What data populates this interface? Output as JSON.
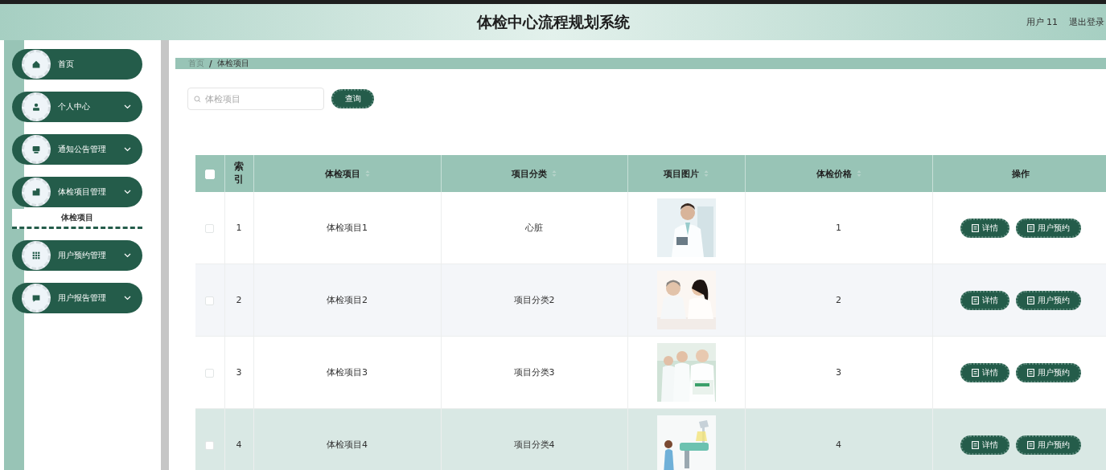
{
  "header": {
    "title": "体检中心流程规划系统",
    "user": "用户 11",
    "logout": "退出登录"
  },
  "sidebar": {
    "items": [
      {
        "label": "首页",
        "expandable": false
      },
      {
        "label": "个人中心",
        "expandable": true
      },
      {
        "label": "通知公告管理",
        "expandable": true
      },
      {
        "label": "体检项目管理",
        "expandable": true,
        "children": [
          {
            "label": "体检项目",
            "selected": true
          }
        ]
      },
      {
        "label": "用户预约管理",
        "expandable": true
      },
      {
        "label": "用户报告管理",
        "expandable": true
      }
    ]
  },
  "breadcrumb": {
    "items": [
      "首页",
      "体检项目"
    ],
    "separator": "/"
  },
  "search": {
    "placeholder": "体检项目",
    "button": "查询"
  },
  "table": {
    "select_all": {
      "checked": false
    },
    "columns": [
      {
        "label": "索引",
        "sortable": false
      },
      {
        "label": "体检项目",
        "sortable": true
      },
      {
        "label": "项目分类",
        "sortable": true
      },
      {
        "label": "项目图片",
        "sortable": true
      },
      {
        "label": "体检价格",
        "sortable": true
      },
      {
        "label": "操作",
        "sortable": false
      }
    ],
    "rows": [
      {
        "checked": false,
        "hovered": false,
        "index": "1",
        "name": "体检项目1",
        "category": "心脏",
        "price": "1",
        "actions": [
          "详情",
          "用户预约"
        ]
      },
      {
        "checked": false,
        "hovered": false,
        "index": "2",
        "name": "体检项目2",
        "category": "项目分类2",
        "price": "2",
        "actions": [
          "详情",
          "用户预约"
        ]
      },
      {
        "checked": false,
        "hovered": false,
        "index": "3",
        "name": "体检项目3",
        "category": "项目分类3",
        "price": "3",
        "actions": [
          "详情",
          "用户预约"
        ]
      },
      {
        "checked": false,
        "hovered": true,
        "index": "4",
        "name": "体检项目4",
        "category": "项目分类4",
        "price": "4",
        "actions": [
          "详情",
          "用户预约"
        ]
      }
    ]
  }
}
